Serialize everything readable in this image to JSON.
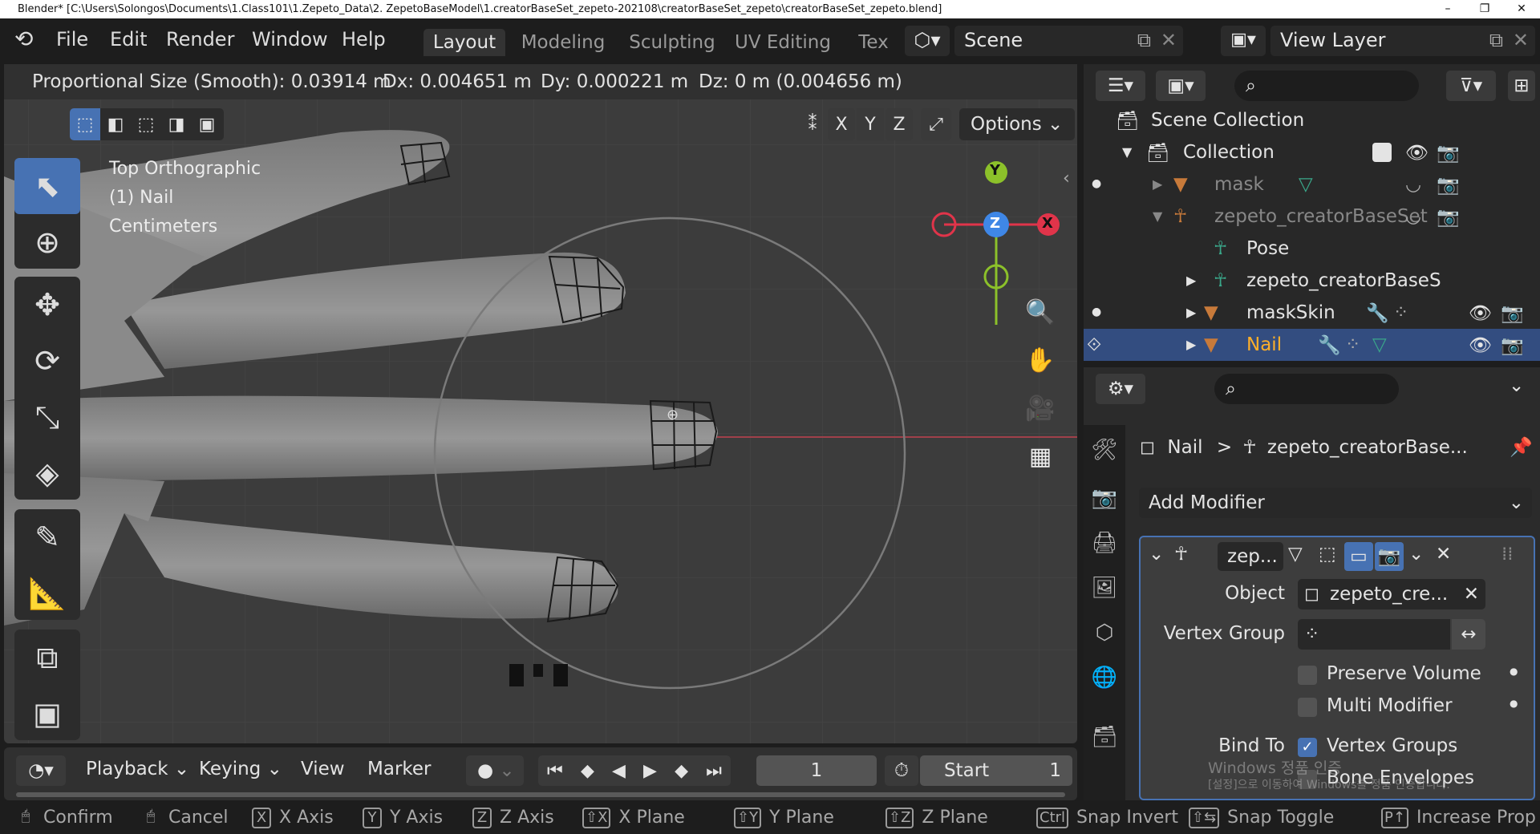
{
  "window": {
    "title": "Blender* [C:\\Users\\Solongos\\Documents\\1.Class101\\1.Zepeto_Data\\2. ZepetoBaseModel\\1.creatorBaseSet_zepeto-202108\\creatorBaseSet_zepeto\\creatorBaseSet_zepeto.blend]",
    "minimize": "–",
    "maximize": "❐",
    "close": "✕"
  },
  "menu": {
    "file": "File",
    "edit": "Edit",
    "render": "Render",
    "window": "Window",
    "help": "Help"
  },
  "workspaces": [
    "Layout",
    "Modeling",
    "Sculpting",
    "UV Editing",
    "Tex"
  ],
  "scene": {
    "name": "Scene",
    "view_layer": "View Layer"
  },
  "header_info": {
    "prop_size": "Proportional Size (Smooth): 0.03914 m",
    "dx": "Dx: 0.004651 m",
    "dy": "Dy: 0.000221 m",
    "dz": "Dz: 0 m (0.004656 m)"
  },
  "viewport": {
    "view": "Top Orthographic",
    "object": "(1) Nail",
    "units": "Centimeters",
    "options": "Options",
    "axes": [
      "X",
      "Y",
      "Z"
    ]
  },
  "gizmo": {
    "x": "X",
    "y": "Y",
    "z": "Z"
  },
  "outliner": {
    "scene_collection": "Scene Collection",
    "collection": "Collection",
    "items": [
      {
        "label": "mask"
      },
      {
        "label": "zepeto_creatorBaseSet"
      },
      {
        "label": "Pose"
      },
      {
        "label": "zepeto_creatorBaseS"
      },
      {
        "label": "maskSkin"
      },
      {
        "label": "Nail"
      }
    ]
  },
  "properties": {
    "breadcrumb_obj": "Nail",
    "breadcrumb_sep": ">",
    "breadcrumb_mod": "zepeto_creatorBase...",
    "add_modifier": "Add Modifier",
    "modifier_name": "zep...",
    "object_label": "Object",
    "object_value": "zepeto_cre...",
    "vgroup_label": "Vertex Group",
    "preserve_volume": "Preserve Volume",
    "multi_modifier": "Multi Modifier",
    "bind_to": "Bind To",
    "vertex_groups": "Vertex Groups",
    "bone_envelopes": "Bone Envelopes"
  },
  "watermark": {
    "line1": "Windows 정품 인증",
    "line2": "[설정]으로 이동하여 Windows를 정품 인증합니다."
  },
  "timeline": {
    "playback": "Playback",
    "keying": "Keying",
    "view": "View",
    "marker": "Marker",
    "frame": "1",
    "start_label": "Start",
    "start_value": "1"
  },
  "statusbar": [
    {
      "key": "",
      "label": "Confirm"
    },
    {
      "key": "",
      "label": "Cancel"
    },
    {
      "key": "X",
      "label": "X Axis"
    },
    {
      "key": "Y",
      "label": "Y Axis"
    },
    {
      "key": "Z",
      "label": "Z Axis"
    },
    {
      "key": "⇧X",
      "label": "X Plane"
    },
    {
      "key": "⇧Y",
      "label": "Y Plane"
    },
    {
      "key": "⇧Z",
      "label": "Z Plane"
    },
    {
      "key": "Ctrl",
      "label": "Snap Invert"
    },
    {
      "key": "⇧⇆",
      "label": "Snap Toggle"
    },
    {
      "key": "P↑",
      "label": "Increase Prop"
    }
  ],
  "colors": {
    "accent": "#4772b3",
    "selected_row": "#334d80",
    "active_text": "#ffaf29",
    "x_axis": "#e0344a",
    "y_axis": "#8cc12a",
    "z_axis": "#3f87e6"
  },
  "icons": [
    "blender-logo-icon",
    "select-box-icon",
    "cursor-icon",
    "move-icon",
    "rotate-icon",
    "scale-icon",
    "transform-icon",
    "annotate-icon",
    "measure-icon",
    "add-cube-icon",
    "cube-icon",
    "zoom-icon",
    "hand-icon",
    "camera-icon",
    "grid-icon",
    "eye-icon",
    "camera-render-icon",
    "wrench-icon",
    "mesh-icon",
    "armature-icon",
    "search-icon",
    "filter-icon",
    "pin-icon",
    "close-icon"
  ]
}
